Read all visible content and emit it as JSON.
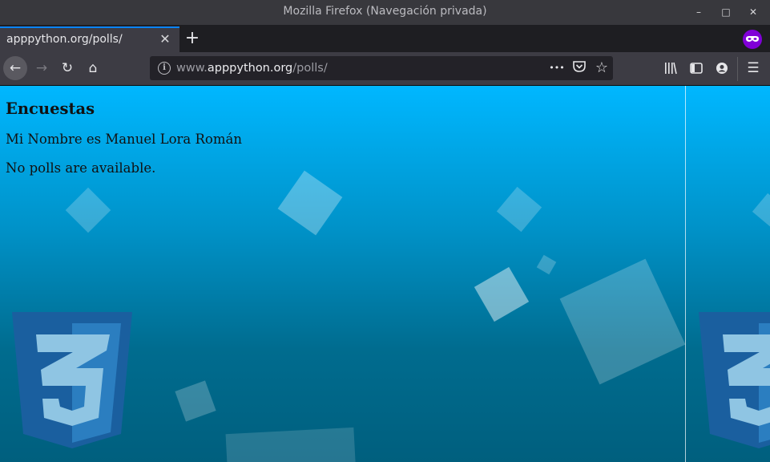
{
  "window": {
    "title": "Mozilla Firefox (Navegación privada)",
    "minimize_label": "–",
    "maximize_label": "□",
    "close_label": "✕"
  },
  "tabs": [
    {
      "label": "apppython.org/polls/"
    }
  ],
  "tab_close_label": "✕",
  "new_tab_label": "+",
  "nav": {
    "back": "←",
    "forward": "→",
    "reload": "↻",
    "home": "⌂",
    "url_prefix": "www.",
    "url_host": "apppython.org",
    "url_path": "/polls/",
    "info": "i",
    "more": "•••",
    "pocket": "◡",
    "bookmark": "☆",
    "library": "⫴",
    "sidebar": "◫",
    "account": "◉",
    "menu": "☰"
  },
  "icons": {
    "private_browsing": "mask-icon",
    "css3_logo": "css3-logo"
  },
  "page": {
    "heading": "Encuestas",
    "author": "Mi Nombre es Manuel Lora Román",
    "message": "No polls are available."
  },
  "colors": {
    "accent": "#0a84ff",
    "private": "#8000d7",
    "background_top": "#00b7ff",
    "background_bottom": "#005f7e",
    "css3_blue": "#1a5f9f"
  }
}
